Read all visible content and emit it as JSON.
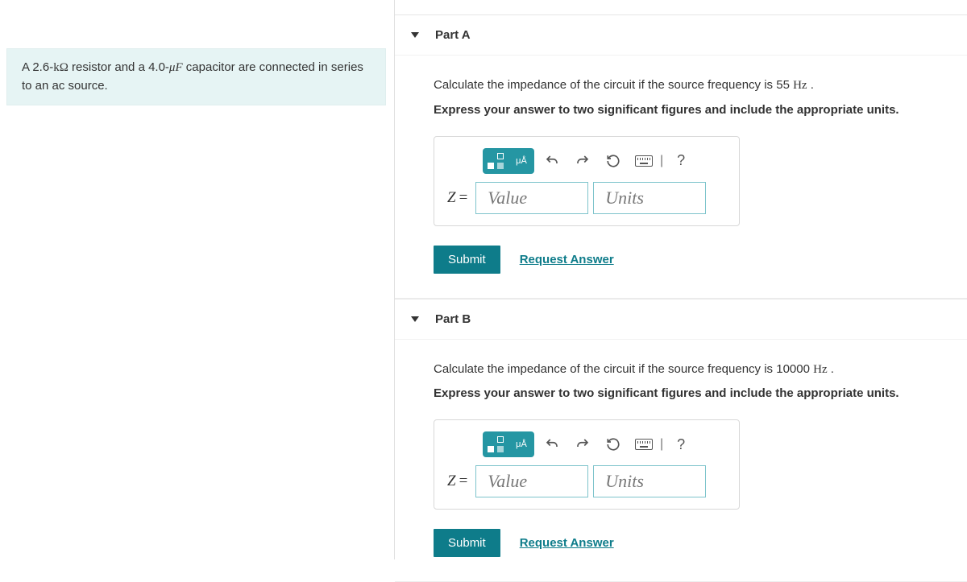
{
  "problem": {
    "text_before": "A 2.6-",
    "unit1": "kΩ",
    "text_mid1": " resistor and a 4.0-",
    "unit2": "μF",
    "text_after": " capacitor are connected in series to an ac source."
  },
  "parts": {
    "a": {
      "title": "Part A",
      "question_before": "Calculate the impedance of the circuit if the source frequency is 55 ",
      "question_unit": "Hz",
      "question_after": " .",
      "instruction": "Express your answer to two significant figures and include the appropriate units.",
      "variable": "Z",
      "equals": "=",
      "value_placeholder": "Value",
      "units_placeholder": "Units",
      "submit_label": "Submit",
      "request_label": "Request Answer",
      "help_label": "?"
    },
    "b": {
      "title": "Part B",
      "question_before": "Calculate the impedance of the circuit if the source frequency is 10000 ",
      "question_unit": "Hz",
      "question_after": " .",
      "instruction": "Express your answer to two significant figures and include the appropriate units.",
      "variable": "Z",
      "equals": "=",
      "value_placeholder": "Value",
      "units_placeholder": "Units",
      "submit_label": "Submit",
      "request_label": "Request Answer",
      "help_label": "?"
    }
  },
  "icons": {
    "templates": "templates-icon",
    "special": "μÅ",
    "undo": "undo-icon",
    "redo": "redo-icon",
    "reset": "reset-icon",
    "keyboard": "keyboard-icon"
  }
}
